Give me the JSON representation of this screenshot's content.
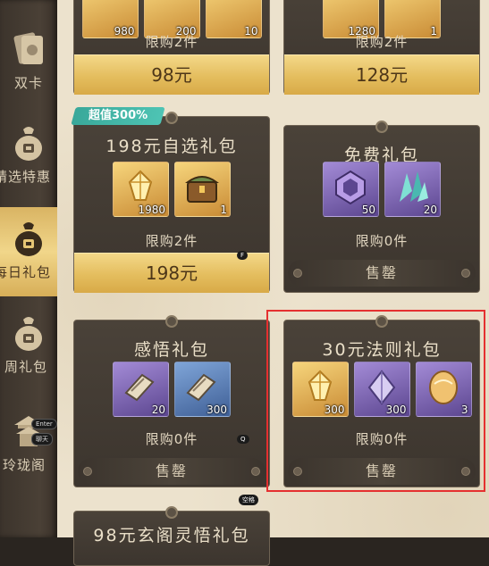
{
  "sidebar": {
    "items": [
      {
        "label": "双卡",
        "icon": "card-icon",
        "active": false
      },
      {
        "label": "精选特惠",
        "icon": "money-bag-icon",
        "active": false
      },
      {
        "label": "每日礼包",
        "icon": "money-bag-icon",
        "active": true
      },
      {
        "label": "周礼包",
        "icon": "money-bag-icon",
        "active": false
      },
      {
        "label": "玲珑阁",
        "icon": "pavilion-icon",
        "active": false
      }
    ],
    "key_hints": {
      "enter": "Enter",
      "chat": "聊天"
    }
  },
  "cards": {
    "top_left": {
      "items": [
        {
          "qty": "980"
        },
        {
          "qty": "200"
        },
        {
          "qty": "10"
        }
      ],
      "limit": "限购2件",
      "price": "98元"
    },
    "top_right": {
      "items": [
        {
          "qty": "1280"
        },
        {
          "qty": "1"
        }
      ],
      "limit": "限购2件",
      "price": "128元"
    },
    "pack_198": {
      "badge": "超值300%",
      "title": "198元自选礼包",
      "items": [
        {
          "qty": "1980",
          "icon": "gold-crystal-icon"
        },
        {
          "qty": "1",
          "icon": "treasure-chest-icon"
        }
      ],
      "limit": "限购2件",
      "price": "198元",
      "key_hint": "F"
    },
    "free_pack": {
      "title": "免费礼包",
      "items": [
        {
          "qty": "50",
          "icon": "purple-ring-icon"
        },
        {
          "qty": "20",
          "icon": "crystal-shard-icon"
        }
      ],
      "limit": "限购0件",
      "button": "售罄"
    },
    "insight_pack": {
      "title": "感悟礼包",
      "items": [
        {
          "qty": "20",
          "icon": "scroll-icon"
        },
        {
          "qty": "300",
          "icon": "scroll-icon"
        }
      ],
      "limit": "限购0件",
      "button": "售罄",
      "key_hint": "Q"
    },
    "rule_pack": {
      "title": "30元法则礼包",
      "items": [
        {
          "qty": "300",
          "icon": "gold-crystal-icon"
        },
        {
          "qty": "300",
          "icon": "purple-gem-icon"
        },
        {
          "qty": "3",
          "icon": "gold-stone-icon"
        }
      ],
      "limit": "限购0件",
      "button": "售罄"
    },
    "bottom_left": {
      "title": "98元玄阁灵悟礼包",
      "key_hint": "空格"
    }
  },
  "colors": {
    "accent_gold": "#e4bd5e",
    "highlight_red": "#e53030",
    "badge_teal": "#3fb3a5"
  }
}
